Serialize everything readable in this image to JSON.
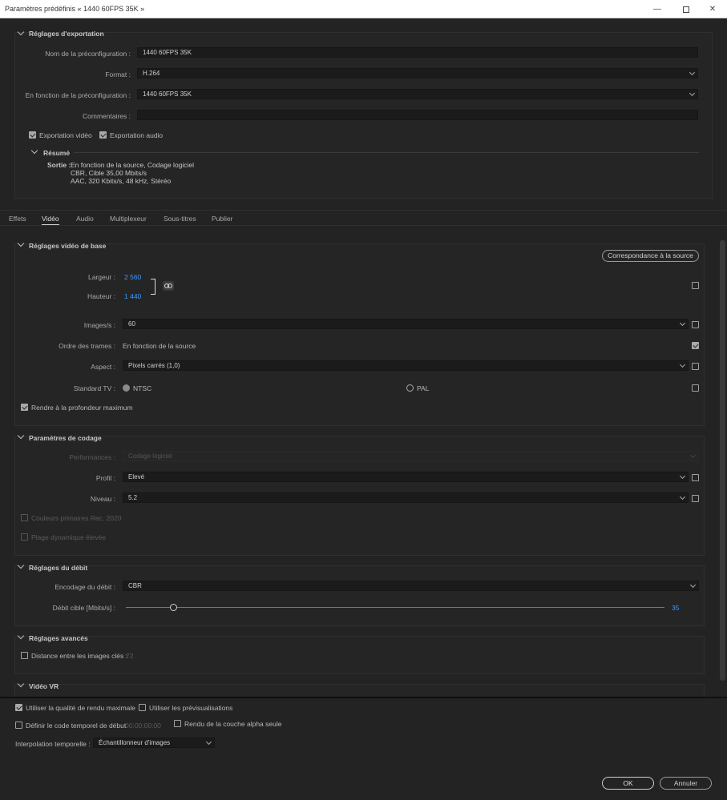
{
  "window": {
    "title": "Paramètres prédéfinis « 1440 60FPS 35K »"
  },
  "export": {
    "title": "Réglages d'exportation",
    "preset_name_label": "Nom de la préconfiguration :",
    "preset_name_value": "1440 60FPS 35K",
    "format_label": "Format :",
    "format_value": "H.264",
    "based_on_label": "En fonction de la préconfiguration :",
    "based_on_value": "1440 60FPS 35K",
    "comments_label": "Commentaires :",
    "comments_value": "",
    "export_video": "Exportation vidéo",
    "export_audio": "Exportation audio",
    "summary_title": "Résumé",
    "output_label": "Sortie :",
    "output_lines": [
      "En fonction de la source, Codage logiciel",
      "CBR, Cible 35,00  Mbits/s",
      "AAC, 320  Kbits/s, 48 kHz, Stéréo"
    ]
  },
  "tabs": [
    "Effets",
    "Vidéo",
    "Audio",
    "Multiplexeur",
    "Sous-titres",
    "Publier"
  ],
  "basic_video": {
    "title": "Réglages vidéo de base",
    "match_source": "Correspondance à la source",
    "width_label": "Largeur :",
    "width_value": "2 560",
    "height_label": "Hauteur :",
    "height_value": "1 440",
    "fps_label": "Images/s :",
    "fps_value": "60",
    "field_order_label": "Ordre des trames :",
    "field_order_value": "En fonction de la source",
    "aspect_label": "Aspect :",
    "aspect_value": "Pixels carrés (1,0)",
    "tv_label": "Standard TV :",
    "ntsc": "NTSC",
    "pal": "PAL",
    "max_depth": "Rendre à la profondeur maximum"
  },
  "encoding": {
    "title": "Paramètres de codage",
    "performance_label": "Performances :",
    "performance_value": "Codage logiciel",
    "profile_label": "Profil :",
    "profile_value": "Elevé",
    "level_label": "Niveau :",
    "level_value": "5.2",
    "rec2020": "Couleurs primaires Rec. 2020",
    "hdr": "Plage dynamique élevée"
  },
  "bitrate": {
    "title": "Réglages du débit",
    "encoding_label": "Encodage du débit :",
    "encoding_value": "CBR",
    "target_label": "Débit cible [Mbits/s] :",
    "target_value": "35",
    "target_fraction": 0.088
  },
  "advanced": {
    "title": "Réglages avancés",
    "keyframe_label": "Distance entre les images clés :",
    "keyframe_value": "72"
  },
  "vr": {
    "title": "Vidéo VR"
  },
  "footer": {
    "max_quality": "Utiliser la qualité de rendu maximale",
    "use_previews": "Utiliser les prévisualisations",
    "start_timecode": "Définir le code temporel de début",
    "timecode_value": "00:00:00:00",
    "alpha_only": "Rendu de la couche alpha seule",
    "interp_label": "Interpolation temporelle :",
    "interp_value": "Échantillonneur d'images",
    "ok": "OK",
    "cancel": "Annuler"
  }
}
